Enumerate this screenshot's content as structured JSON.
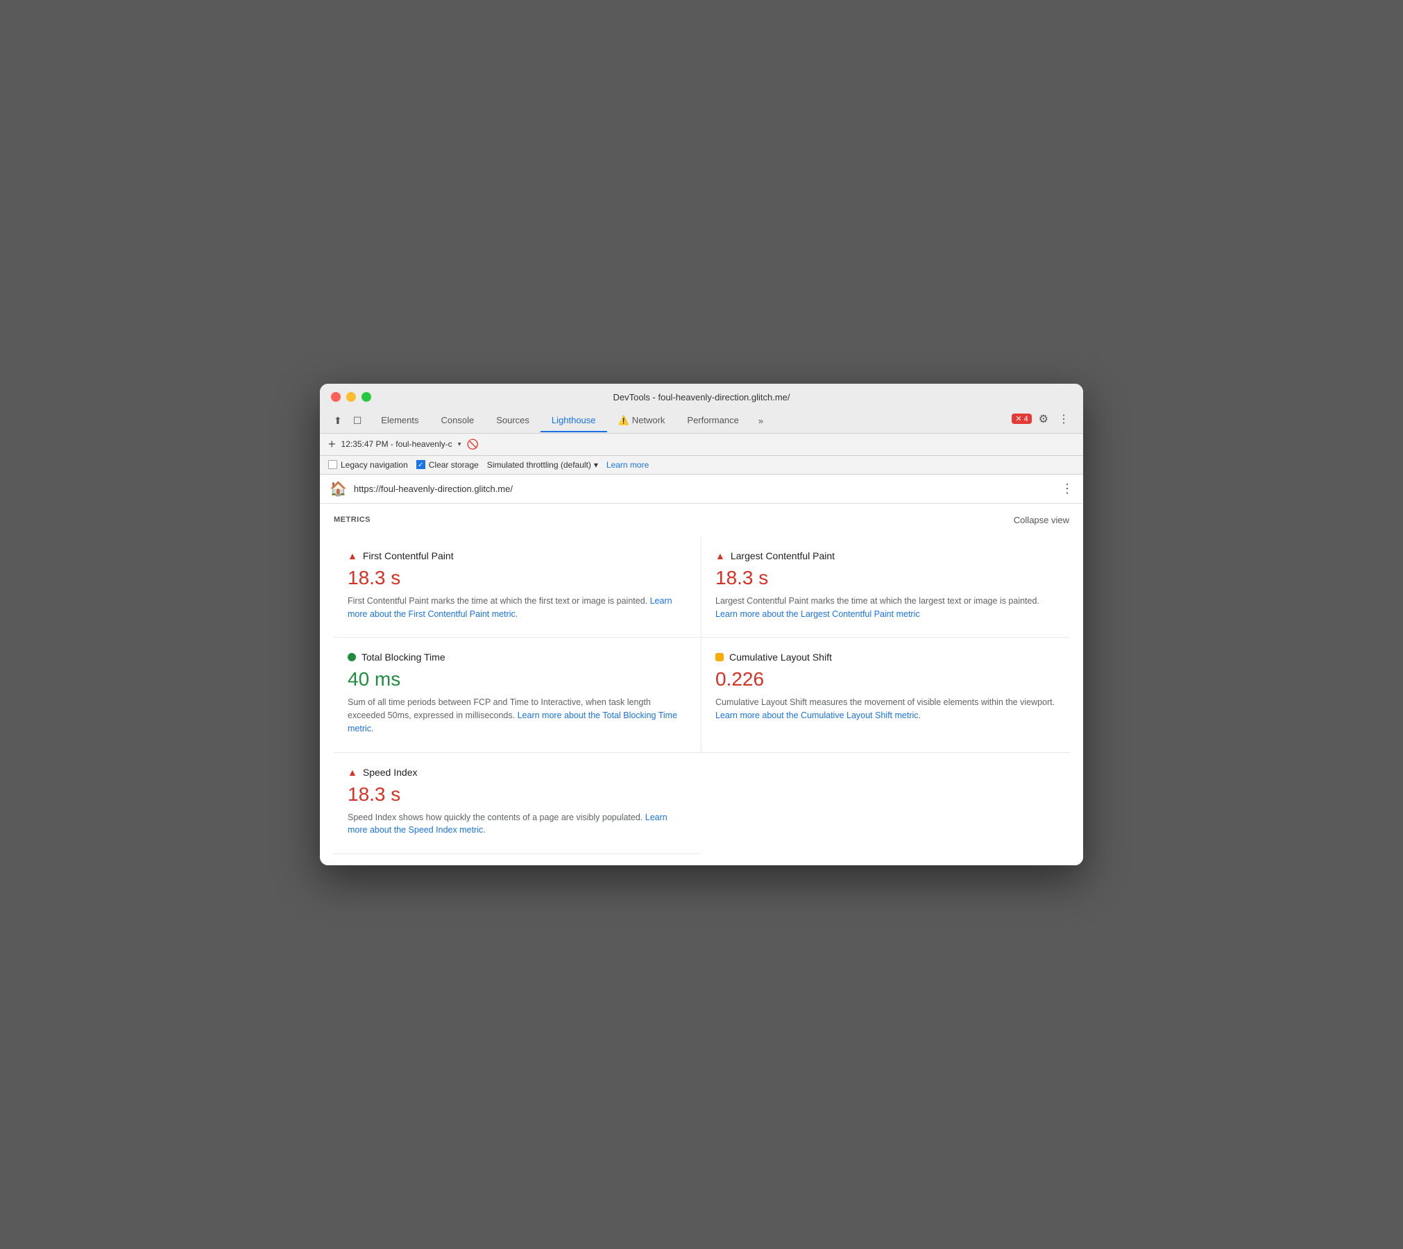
{
  "window": {
    "title": "DevTools - foul-heavenly-direction.glitch.me/"
  },
  "tabs": [
    {
      "label": "Elements",
      "active": false,
      "warning": false
    },
    {
      "label": "Console",
      "active": false,
      "warning": false
    },
    {
      "label": "Sources",
      "active": false,
      "warning": false
    },
    {
      "label": "Lighthouse",
      "active": true,
      "warning": false
    },
    {
      "label": "Network",
      "active": false,
      "warning": true
    },
    {
      "label": "Performance",
      "active": false,
      "warning": false
    }
  ],
  "tab_more": "»",
  "error_badge": {
    "count": "4"
  },
  "toolbar": {
    "legacy_navigation_label": "Legacy navigation",
    "clear_storage_label": "Clear storage",
    "throttling_label": "Simulated throttling (default)",
    "learn_more_label": "Learn more"
  },
  "toolbar2": {
    "time": "12:35:47 PM",
    "url_chip": "foul-heavenly-c",
    "block_icon": "🚫"
  },
  "url_bar": {
    "url": "https://foul-heavenly-direction.glitch.me/"
  },
  "metrics": {
    "title": "METRICS",
    "collapse_label": "Collapse view",
    "items": [
      {
        "name": "First Contentful Paint",
        "value": "18.3 s",
        "value_type": "red",
        "icon_type": "red-triangle",
        "description": "First Contentful Paint marks the time at which the first text or image is painted.",
        "link_text": "Learn more about the First Contentful Paint metric",
        "link_href": "#"
      },
      {
        "name": "Largest Contentful Paint",
        "value": "18.3 s",
        "value_type": "red",
        "icon_type": "red-triangle",
        "description": "Largest Contentful Paint marks the time at which the largest text or image is painted.",
        "link_text": "Learn more about the Largest Contentful Paint metric",
        "link_href": "#"
      },
      {
        "name": "Total Blocking Time",
        "value": "40 ms",
        "value_type": "green",
        "icon_type": "green-circle",
        "description": "Sum of all time periods between FCP and Time to Interactive, when task length exceeded 50ms, expressed in milliseconds.",
        "link_text": "Learn more about the Total Blocking Time metric",
        "link_href": "#"
      },
      {
        "name": "Cumulative Layout Shift",
        "value": "0.226",
        "value_type": "orange",
        "icon_type": "orange-square",
        "description": "Cumulative Layout Shift measures the movement of visible elements within the viewport.",
        "link_text": "Learn more about the Cumulative Layout Shift metric",
        "link_href": "#"
      },
      {
        "name": "Speed Index",
        "value": "18.3 s",
        "value_type": "red",
        "icon_type": "red-triangle",
        "description": "Speed Index shows how quickly the contents of a page are visibly populated.",
        "link_text": "Learn more about the Speed Index metric",
        "link_href": "#",
        "full_width": true
      }
    ]
  }
}
